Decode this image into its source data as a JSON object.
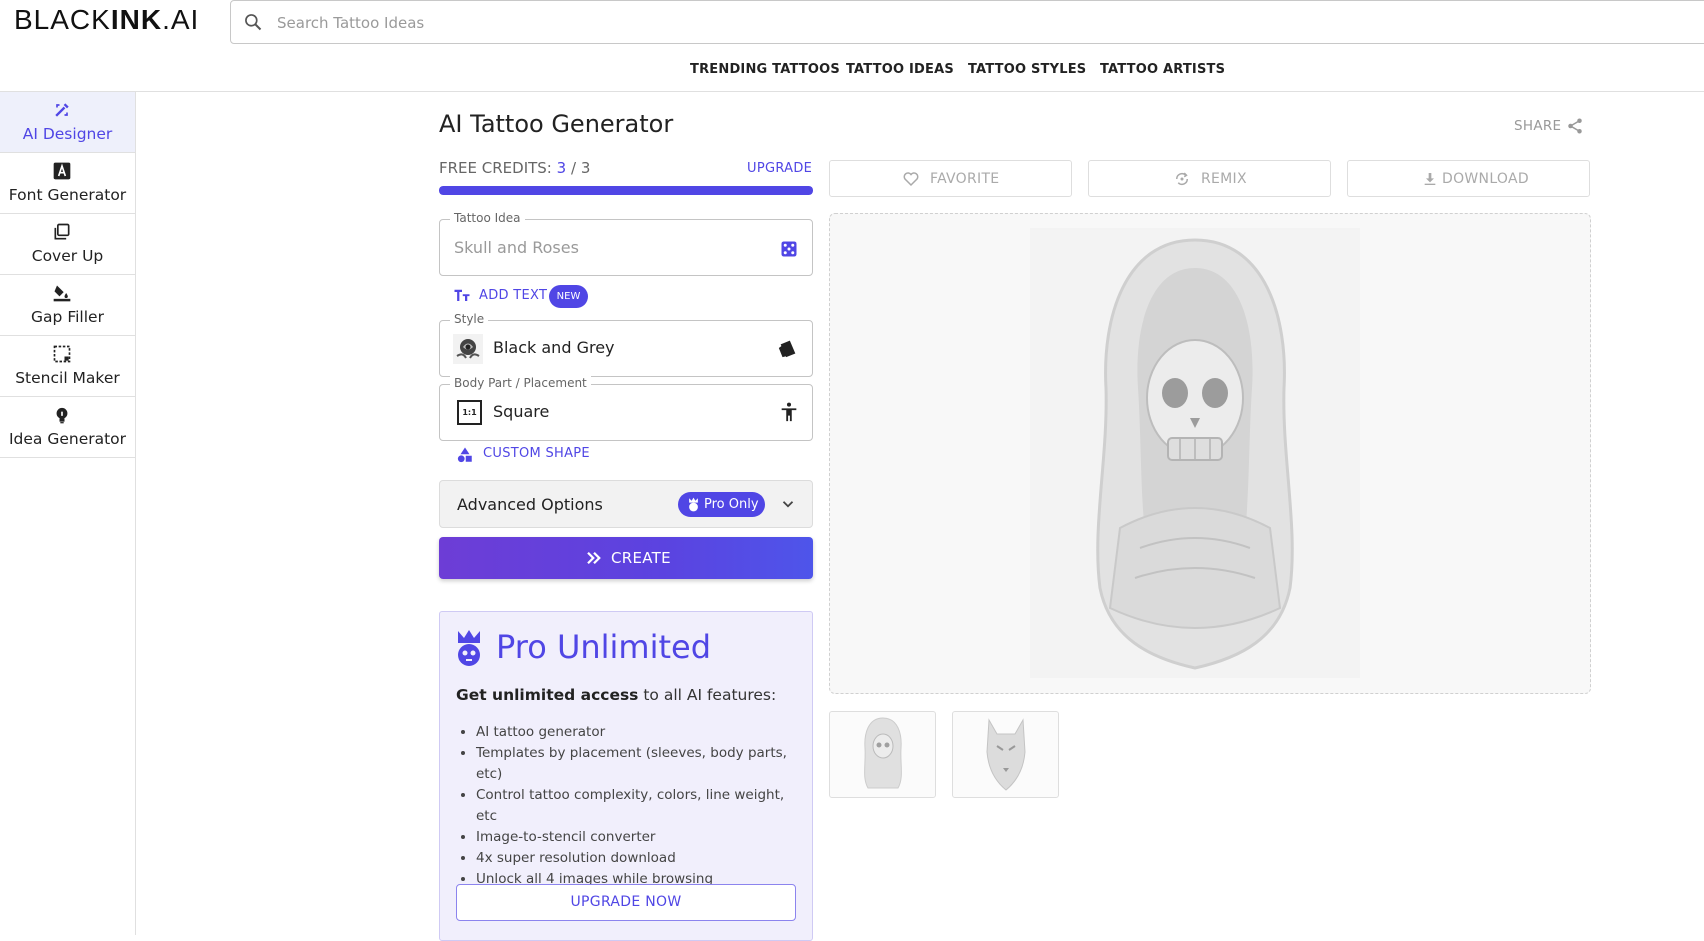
{
  "header": {
    "logo_light": "BLACK",
    "logo_bold": "INK",
    "logo_suffix": ".AI",
    "search_placeholder": "Search Tattoo Ideas"
  },
  "nav": [
    "TRENDING TATTOOS",
    "TATTOO IDEAS",
    "TATTOO STYLES",
    "TATTOO ARTISTS"
  ],
  "sidebar": {
    "items": [
      {
        "label": "AI Designer",
        "icon": "ai-designer-icon",
        "active": true
      },
      {
        "label": "Font Generator",
        "icon": "font-icon"
      },
      {
        "label": "Cover Up",
        "icon": "cover-up-icon"
      },
      {
        "label": "Gap Filler",
        "icon": "paint-bucket-icon"
      },
      {
        "label": "Stencil Maker",
        "icon": "stencil-icon"
      },
      {
        "label": "Idea Generator",
        "icon": "lightbulb-icon"
      }
    ]
  },
  "main": {
    "title": "AI Tattoo Generator",
    "share_label": "SHARE",
    "credits_label": "FREE CREDITS:",
    "credits_used": "3",
    "credits_sep": "/",
    "credits_total": "3",
    "credits_fraction": 1.0,
    "upgrade_label": "UPGRADE",
    "tattoo_idea": {
      "label": "Tattoo Idea",
      "placeholder": "Skull and Roses"
    },
    "add_text_label": "ADD TEXT",
    "new_badge": "NEW",
    "style": {
      "label": "Style",
      "value": "Black and Grey"
    },
    "placement": {
      "label": "Body Part / Placement",
      "value": "Square",
      "icon_text": "1:1"
    },
    "custom_shape_label": "CUSTOM SHAPE",
    "advanced_label": "Advanced Options",
    "pro_only_label": "Pro Only",
    "create_label": "CREATE"
  },
  "pro_box": {
    "title": "Pro Unlimited",
    "subtitle_bold": "Get unlimited access",
    "subtitle_rest": " to all AI features:",
    "features": [
      "AI tattoo generator",
      "Templates by placement (sleeves, body parts, etc)",
      "Control tattoo complexity, colors, line weight, etc",
      "Image-to-stencil converter",
      "4x super resolution download",
      "Unlock all 4 images while browsing"
    ],
    "button_label": "UPGRADE NOW"
  },
  "actions": {
    "favorite": "FAVORITE",
    "remix": "REMIX",
    "download": "DOWNLOAD"
  },
  "colors": {
    "accent": "#5046e5",
    "accent_light": "#f1effc"
  }
}
